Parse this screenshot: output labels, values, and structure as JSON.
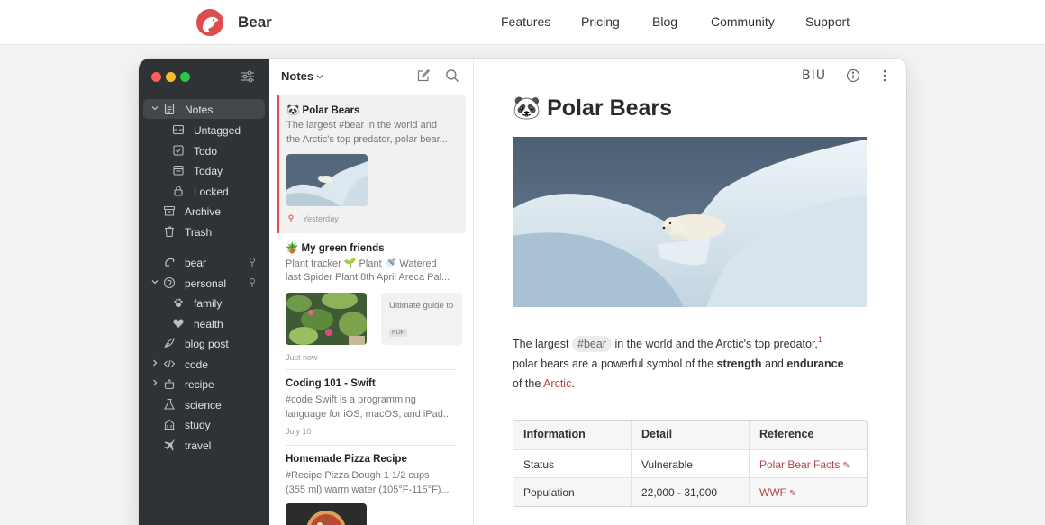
{
  "site": {
    "brand": "Bear",
    "nav": [
      "Features",
      "Pricing",
      "Blog",
      "Community",
      "Support"
    ],
    "accent": "#dd4c4f"
  },
  "sidebar": {
    "items": [
      {
        "label": "Notes",
        "icon": "notes-icon",
        "active": true,
        "expandable": true
      },
      {
        "label": "Untagged",
        "icon": "untagged-icon"
      },
      {
        "label": "Todo",
        "icon": "todo-checkbox-icon"
      },
      {
        "label": "Today",
        "icon": "calendar-icon"
      },
      {
        "label": "Locked",
        "icon": "lock-icon"
      },
      {
        "label": "Archive",
        "icon": "archive-icon"
      },
      {
        "label": "Trash",
        "icon": "trash-icon"
      },
      {
        "label": "bear",
        "icon": "bear-tag-icon",
        "pinned": true
      },
      {
        "label": "personal",
        "icon": "person-tag-icon",
        "pinned": true,
        "expandable": true
      },
      {
        "label": "family",
        "icon": "paw-icon"
      },
      {
        "label": "health",
        "icon": "heart-icon"
      },
      {
        "label": "blog post",
        "icon": "feather-icon"
      },
      {
        "label": "code",
        "icon": "code-icon",
        "expandable": true
      },
      {
        "label": "recipe",
        "icon": "pot-icon",
        "expandable": true
      },
      {
        "label": "science",
        "icon": "flask-icon"
      },
      {
        "label": "study",
        "icon": "building-icon"
      },
      {
        "label": "travel",
        "icon": "plane-icon"
      }
    ]
  },
  "note_list": {
    "title": "Notes",
    "notes": [
      {
        "emoji": "🐼",
        "title": "Polar Bears",
        "lines": [
          "The largest #bear in the world and",
          "the Arctic's top predator, polar bear..."
        ],
        "date": "Yesterday",
        "pinned": true
      },
      {
        "emoji": "🪴",
        "title": "My green friends",
        "lines": [
          "Plant tracker 🌱 Plant 🚿 Watered",
          "last Spider Plant 8th April Areca Pal..."
        ],
        "attachment": {
          "text": "Ultimate guide to",
          "badge": "PDF"
        },
        "date": "Just now"
      },
      {
        "title": "Coding 101 - Swift",
        "lines": [
          "#code Swift is a programming",
          "language for iOS, macOS, and iPad..."
        ],
        "date": "July 10"
      },
      {
        "title": "Homemade Pizza Recipe",
        "lines": [
          "#Recipe Pizza Dough 1 1/2 cups",
          "(355 ml) warm water (105°F-115°F)..."
        ]
      }
    ]
  },
  "editor": {
    "toolbar": {
      "format": "BIU"
    },
    "title_emoji": "🐼",
    "title": "Polar Bears",
    "para": {
      "l1_a": "The largest ",
      "tag": "#bear",
      "l1_b": " in the world and the Arctic's top predator,",
      "footnote": "1",
      "l2_a": "polar bears are a powerful symbol of the ",
      "strength": "strength",
      "l2_b": " and ",
      "endurance": "endurance",
      "l3_a": "of the ",
      "arctic": "Arctic",
      "l3_b": "."
    },
    "table": {
      "headers": [
        "Information",
        "Detail",
        "Reference"
      ],
      "rows": [
        [
          "Status",
          "Vulnerable",
          "Polar Bear Facts"
        ],
        [
          "Population",
          "22,000 - 31,000",
          "WWF"
        ]
      ]
    }
  }
}
